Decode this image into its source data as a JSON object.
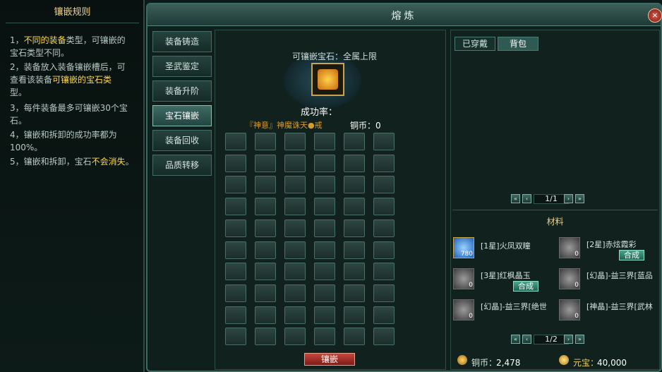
{
  "rules": {
    "title": "镶嵌规则",
    "l1a": "1，",
    "l1b": "不同的装备",
    "l1c": "类型，可镶嵌的",
    "l2": "宝石类型不同。",
    "l3": "2，装备放入装备镶嵌槽后，可",
    "l4a": "查看该装备",
    "l4b": "可镶嵌的宝石类",
    "l5": "型。",
    "l6": "3，每件装备最多可镶嵌30个宝",
    "l7": "石。",
    "l8": "4，镶嵌和拆卸的成功率都为",
    "l9": "100%。",
    "l10a": "5，镶嵌和拆卸，宝石",
    "l10b": "不会消失",
    "l10c": "。"
  },
  "window": {
    "title": "熔炼",
    "close_label": "×"
  },
  "tabs": [
    "装备铸造",
    "圣武鉴定",
    "装备升阶",
    "宝石镶嵌",
    "装备回收",
    "品质转移"
  ],
  "center": {
    "slot_hint": "可镶嵌宝石：全属上限",
    "success_label": "成功率：",
    "item_name": "『神意』神魔诛天●戒",
    "coin_label": "铜币：0",
    "inlay_button": "镶嵌"
  },
  "right": {
    "tab_equipped": "已穿戴",
    "tab_bag": "背包",
    "page_top": "1/1",
    "materials_title": "材料",
    "materials": [
      {
        "name": "[1星]火凤双瞳",
        "count": "780",
        "icon": "blue-gem-icon",
        "synth": ""
      },
      {
        "name": "[2星]赤炫霞彩",
        "count": "0",
        "icon": "gray-gem-icon",
        "synth": "合成"
      },
      {
        "name": "[3星]红枫晶玉",
        "count": "0",
        "icon": "gray-gem-icon",
        "synth": "合成"
      },
      {
        "name": "[幻晶]-益三界[蓝品",
        "count": "0",
        "icon": "gray-gem-icon",
        "synth": ""
      },
      {
        "name": "[幻晶]-益三界[绝世",
        "count": "0",
        "icon": "gray-gem-icon",
        "synth": ""
      },
      {
        "name": "[神晶]-益三界[武林",
        "count": "0",
        "icon": "gray-gem-icon",
        "synth": ""
      }
    ],
    "page_bottom": "1/2",
    "copper_label": "铜币：",
    "copper_value": "2,478",
    "yuanbao_label": "元宝：",
    "yuanbao_value": "40,000"
  }
}
